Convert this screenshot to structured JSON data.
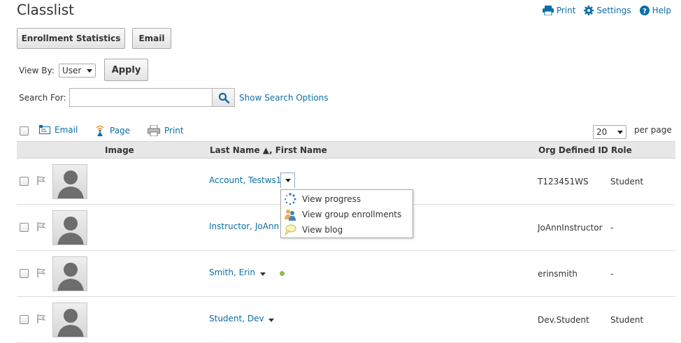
{
  "page": {
    "title": "Classlist",
    "links": {
      "print": "Print",
      "settings": "Settings",
      "help": "Help"
    }
  },
  "toolbar": {
    "enrollment_stats": "Enrollment Statistics",
    "email": "Email"
  },
  "view_by": {
    "label": "View By:",
    "value": "User",
    "apply": "Apply"
  },
  "search": {
    "label": "Search For:",
    "value": "",
    "options_link": "Show Search Options"
  },
  "actions": {
    "email": "Email",
    "page": "Page",
    "print": "Print",
    "per_page_value": "20",
    "per_page_label": "per page"
  },
  "table": {
    "headers": {
      "image": "Image",
      "name": "Last Name ▲, First Name",
      "org_id": "Org Defined ID",
      "role": "Role"
    },
    "rows": [
      {
        "name": "Account, Testws1",
        "org_id": "T123451WS",
        "role": "Student"
      },
      {
        "name": "Instructor, JoAnn",
        "org_id": "JoAnnInstructor",
        "role": "-"
      },
      {
        "name": "Smith, Erin",
        "org_id": "erinsmith",
        "role": "-",
        "online": true
      },
      {
        "name": "Student, Dev",
        "org_id": "Dev.Student",
        "role": "Student"
      }
    ]
  },
  "context_menu": {
    "items": [
      "View progress",
      "View group enrollments",
      "View blog"
    ]
  },
  "colors": {
    "link": "#0a6ea5",
    "header_bg": "#e7e7e7",
    "online_dot": "#8dbb4a"
  }
}
